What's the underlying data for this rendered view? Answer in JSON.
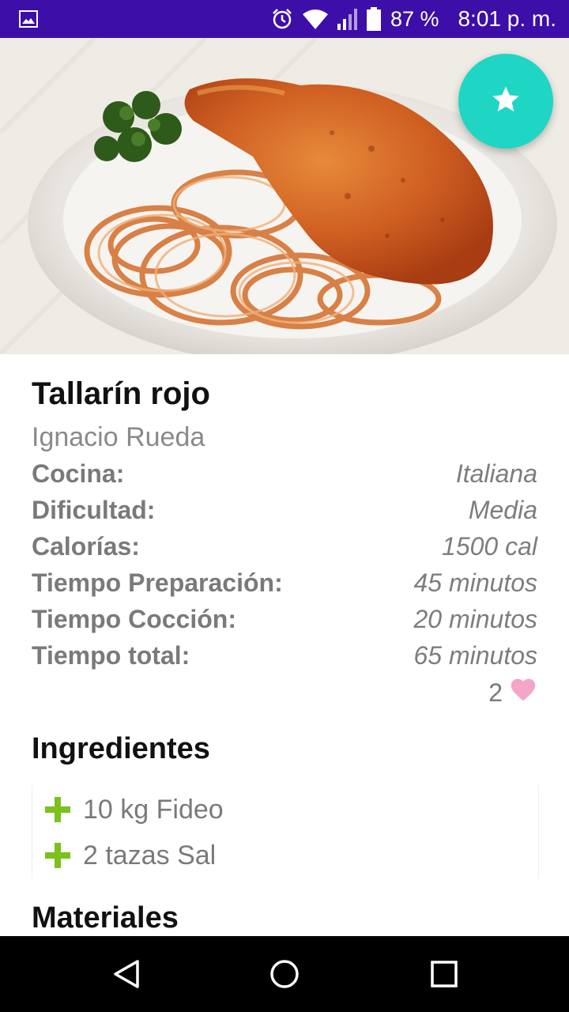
{
  "status_bar": {
    "battery_percent": "87 %",
    "time": "8:01 p. m.",
    "icons": [
      "image-icon",
      "alarm-icon",
      "wifi-icon",
      "signal-icon",
      "battery-icon"
    ]
  },
  "hero": {
    "image": "recipe-photo-chicken-spaghetti",
    "fab_icon": "star-icon",
    "fab_color": "#1fd6c4"
  },
  "recipe": {
    "title": "Tallarín rojo",
    "author": "Ignacio Rueda",
    "details": [
      {
        "label": "Cocina:",
        "value": "Italiana"
      },
      {
        "label": "Dificultad:",
        "value": "Media"
      },
      {
        "label": "Calorías:",
        "value": "1500 cal"
      },
      {
        "label": "Tiempo Preparación:",
        "value": "45 minutos"
      },
      {
        "label": "Tiempo Cocción:",
        "value": "20 minutos"
      },
      {
        "label": "Tiempo total:",
        "value": "65 minutos"
      }
    ],
    "likes": "2",
    "like_icon": "heart-icon",
    "heart_color": "#f3a6c8"
  },
  "ingredients": {
    "title": "Ingredientes",
    "items": [
      {
        "text": "10 kg Fideo",
        "icon": "plus-icon"
      },
      {
        "text": "2 tazas Sal",
        "icon": "plus-icon"
      }
    ],
    "icon_color": "#7cc11c"
  },
  "materials": {
    "title": "Materiales"
  },
  "nav": {
    "icons": [
      "back-icon",
      "home-icon",
      "recents-icon"
    ]
  },
  "colors": {
    "status_bar": "#3d0ea8",
    "accent": "#1fd6c4"
  }
}
